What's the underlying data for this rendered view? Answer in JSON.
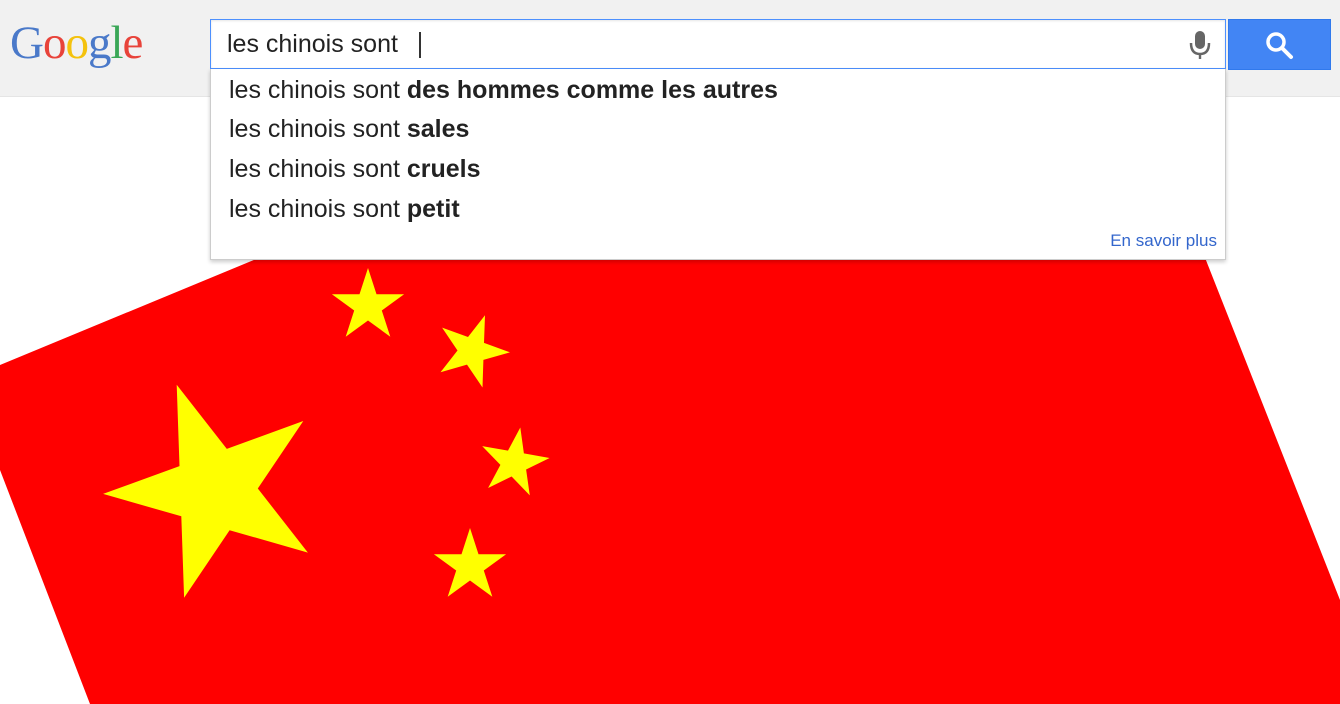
{
  "logo": {
    "letters": [
      "G",
      "o",
      "o",
      "g",
      "l",
      "e"
    ],
    "colors": [
      "#4a79c9",
      "#e8433a",
      "#f4c20d",
      "#4a79c9",
      "#3aa757",
      "#e8433a"
    ]
  },
  "search": {
    "query": "les chinois sont ",
    "mic_icon": "microphone-icon",
    "button_icon": "magnifier-icon",
    "accent_color": "#4285f4"
  },
  "suggestions": {
    "items": [
      {
        "prefix": "les chinois sont ",
        "completion": "des hommes comme les autres"
      },
      {
        "prefix": "les chinois sont ",
        "completion": "sales"
      },
      {
        "prefix": "les chinois sont ",
        "completion": "cruels"
      },
      {
        "prefix": "les chinois sont ",
        "completion": "petit"
      }
    ],
    "learn_more": "En savoir plus"
  },
  "flag": {
    "background_color": "#ff0000",
    "star_color": "#ffff00"
  }
}
